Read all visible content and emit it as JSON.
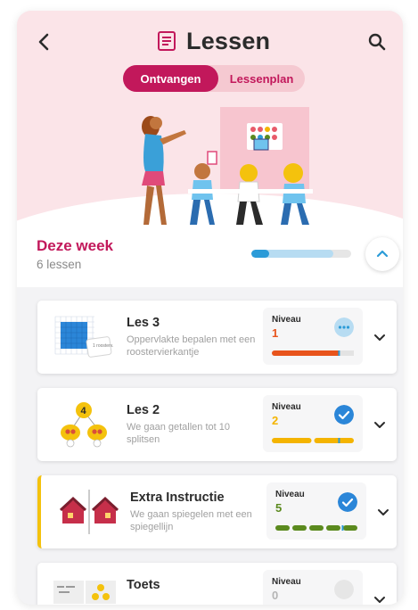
{
  "header": {
    "title": "Lessen",
    "back_icon": "back-arrow-icon",
    "title_icon": "lesson-list-icon",
    "search_icon": "search-icon"
  },
  "tabs": [
    {
      "label": "Ontvangen",
      "active": true
    },
    {
      "label": "Lessenplan",
      "active": false
    }
  ],
  "week": {
    "title": "Deze week",
    "subtitle": "6 lessen",
    "progress_done": 0.18,
    "progress_received": 0.82
  },
  "lessons": [
    {
      "title": "Les 3",
      "description": "Oppervlakte bepalen met een roostervierkantje",
      "level_label": "Niveau",
      "level_value": "1",
      "level_color": "#e8541c",
      "status": "in-progress",
      "status_icon": "dots-icon",
      "progress": 0.82,
      "accent": false,
      "thumb_icon": "grid-area-icon",
      "thumb_text": "1 roosterv."
    },
    {
      "title": "Les 2",
      "description": "We gaan getallen tot 10 splitsen",
      "level_label": "Niveau",
      "level_value": "2",
      "level_color": "#f4b400",
      "status": "done",
      "status_icon": "check-icon",
      "progress": 0.82,
      "accent": false,
      "thumb_icon": "split-numbers-icon",
      "thumb_text": "4"
    },
    {
      "title": "Extra Instructie",
      "description": "We gaan spiegelen met een spiegellijn",
      "level_label": "Niveau",
      "level_value": "5",
      "level_color": "#5b8a1e",
      "status": "done",
      "status_icon": "check-icon",
      "progress": 0.82,
      "accent": true,
      "thumb_icon": "mirror-houses-icon",
      "thumb_text": ""
    },
    {
      "title": "Toets",
      "description": "",
      "level_label": "Niveau",
      "level_value": "0",
      "level_color": "#b5b5b5",
      "status": "not-started",
      "status_icon": "empty-circle-icon",
      "progress": 0,
      "accent": false,
      "thumb_icon": "test-icon",
      "thumb_text": ""
    }
  ],
  "colors": {
    "brand": "#c2185b",
    "brand_light": "#f5c9d1",
    "blue": "#2b9bd8"
  }
}
